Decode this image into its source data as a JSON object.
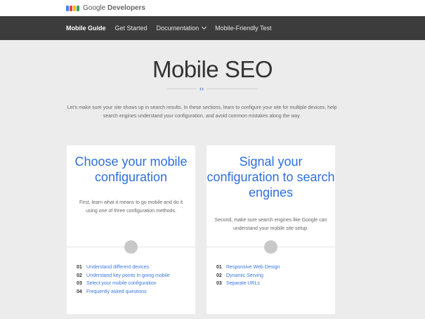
{
  "header": {
    "brand_prefix": "Google",
    "brand_suffix": "Developers",
    "logo_colors": [
      "#4285f4",
      "#ea4335",
      "#fbbc05",
      "#34a853"
    ]
  },
  "nav": {
    "items": [
      {
        "label": "Mobile Guide",
        "active": true
      },
      {
        "label": "Get Started",
        "active": false
      },
      {
        "label": "Documentation",
        "active": false,
        "has_dropdown": true
      },
      {
        "label": "Mobile-Friendly Test",
        "active": false
      }
    ]
  },
  "main": {
    "title": "Mobile SEO",
    "divider_icon": "code-brackets-icon",
    "intro": "Let's make sure your site shows up in search results. In these sections, learn to configure your site for multiple devices, help search engines understand your configuration, and avoid common mistakes along the way."
  },
  "cards": [
    {
      "title": "Choose your mobile configuration",
      "description": "First, learn what it means to go mobile and do it using one of three configuration methods.",
      "steps": [
        {
          "num": "01",
          "label": "Understand different devices"
        },
        {
          "num": "02",
          "label": "Understand key points in going mobile"
        },
        {
          "num": "03",
          "label": "Select your mobile configuration"
        },
        {
          "num": "04",
          "label": "Frequently asked questions"
        }
      ]
    },
    {
      "title": "Signal your configuration to search engines",
      "description": "Second, make sure search engines like Google can understand your mobile site setup.",
      "steps": [
        {
          "num": "01",
          "label": "Responsive Web Design"
        },
        {
          "num": "02",
          "label": "Dynamic Serving"
        },
        {
          "num": "03",
          "label": "Separate URLs"
        }
      ]
    }
  ],
  "colors": {
    "nav_bg": "#3c3c3c",
    "link": "#3a78e0",
    "card_title": "#2f6fdc",
    "page_bg": "#ececec"
  }
}
